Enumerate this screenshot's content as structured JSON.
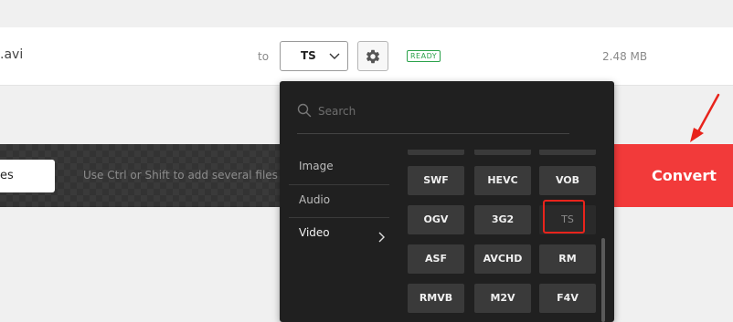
{
  "file": {
    "name": ".avi",
    "to_label": "to",
    "target_format": "TS",
    "status": "READY",
    "size": "2.48 MB"
  },
  "actions": {
    "add_files_label": "es",
    "hint": "Use Ctrl or Shift to add several files a",
    "convert_label": "Convert"
  },
  "dropdown": {
    "search_placeholder": "Search",
    "categories": [
      {
        "label": "Image"
      },
      {
        "label": "Audio"
      },
      {
        "label": "Video"
      }
    ],
    "active_category": "Video",
    "formats": [
      "SWF",
      "HEVC",
      "VOB",
      "OGV",
      "3G2",
      "TS",
      "ASF",
      "AVCHD",
      "RM",
      "RMVB",
      "M2V",
      "F4V"
    ],
    "selected_format": "TS"
  },
  "colors": {
    "convert_red": "#f23a3a",
    "ready_green": "#2aa24a",
    "dropdown_bg": "#202020",
    "highlight_red": "#e8241c"
  },
  "icons": {
    "settings": "gear-icon",
    "select_chevron": "chevron-down-icon",
    "search": "search-icon",
    "category_chevron": "chevron-right-icon",
    "annotation": "red-arrow-icon"
  }
}
